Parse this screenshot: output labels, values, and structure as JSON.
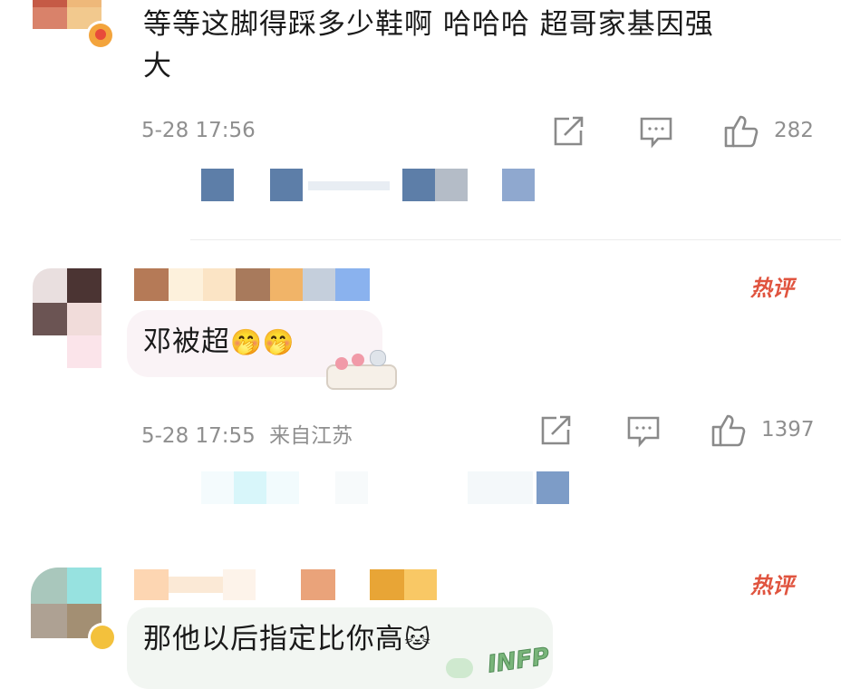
{
  "comments": [
    {
      "text_line1": "等等这脚得踩多少鞋啊 哈哈哈 超哥家基因强",
      "text_line2": "大",
      "time": "5-28 17:56",
      "location": "",
      "likes": "282"
    },
    {
      "text": "邓被超",
      "emoji": "🤭🤭",
      "time": "5-28 17:55",
      "location": "来自江苏",
      "likes": "1397",
      "hot_label": "热评"
    },
    {
      "text": "那他以后指定比你高",
      "emoji": "🐱",
      "hot_label": "热评",
      "sticker_text": "INFP"
    }
  ],
  "icons": [
    "share-icon",
    "comment-icon",
    "like-icon"
  ],
  "colors": {
    "meta_gray": "#8f8f8f",
    "hot_red": "#e0543f"
  }
}
